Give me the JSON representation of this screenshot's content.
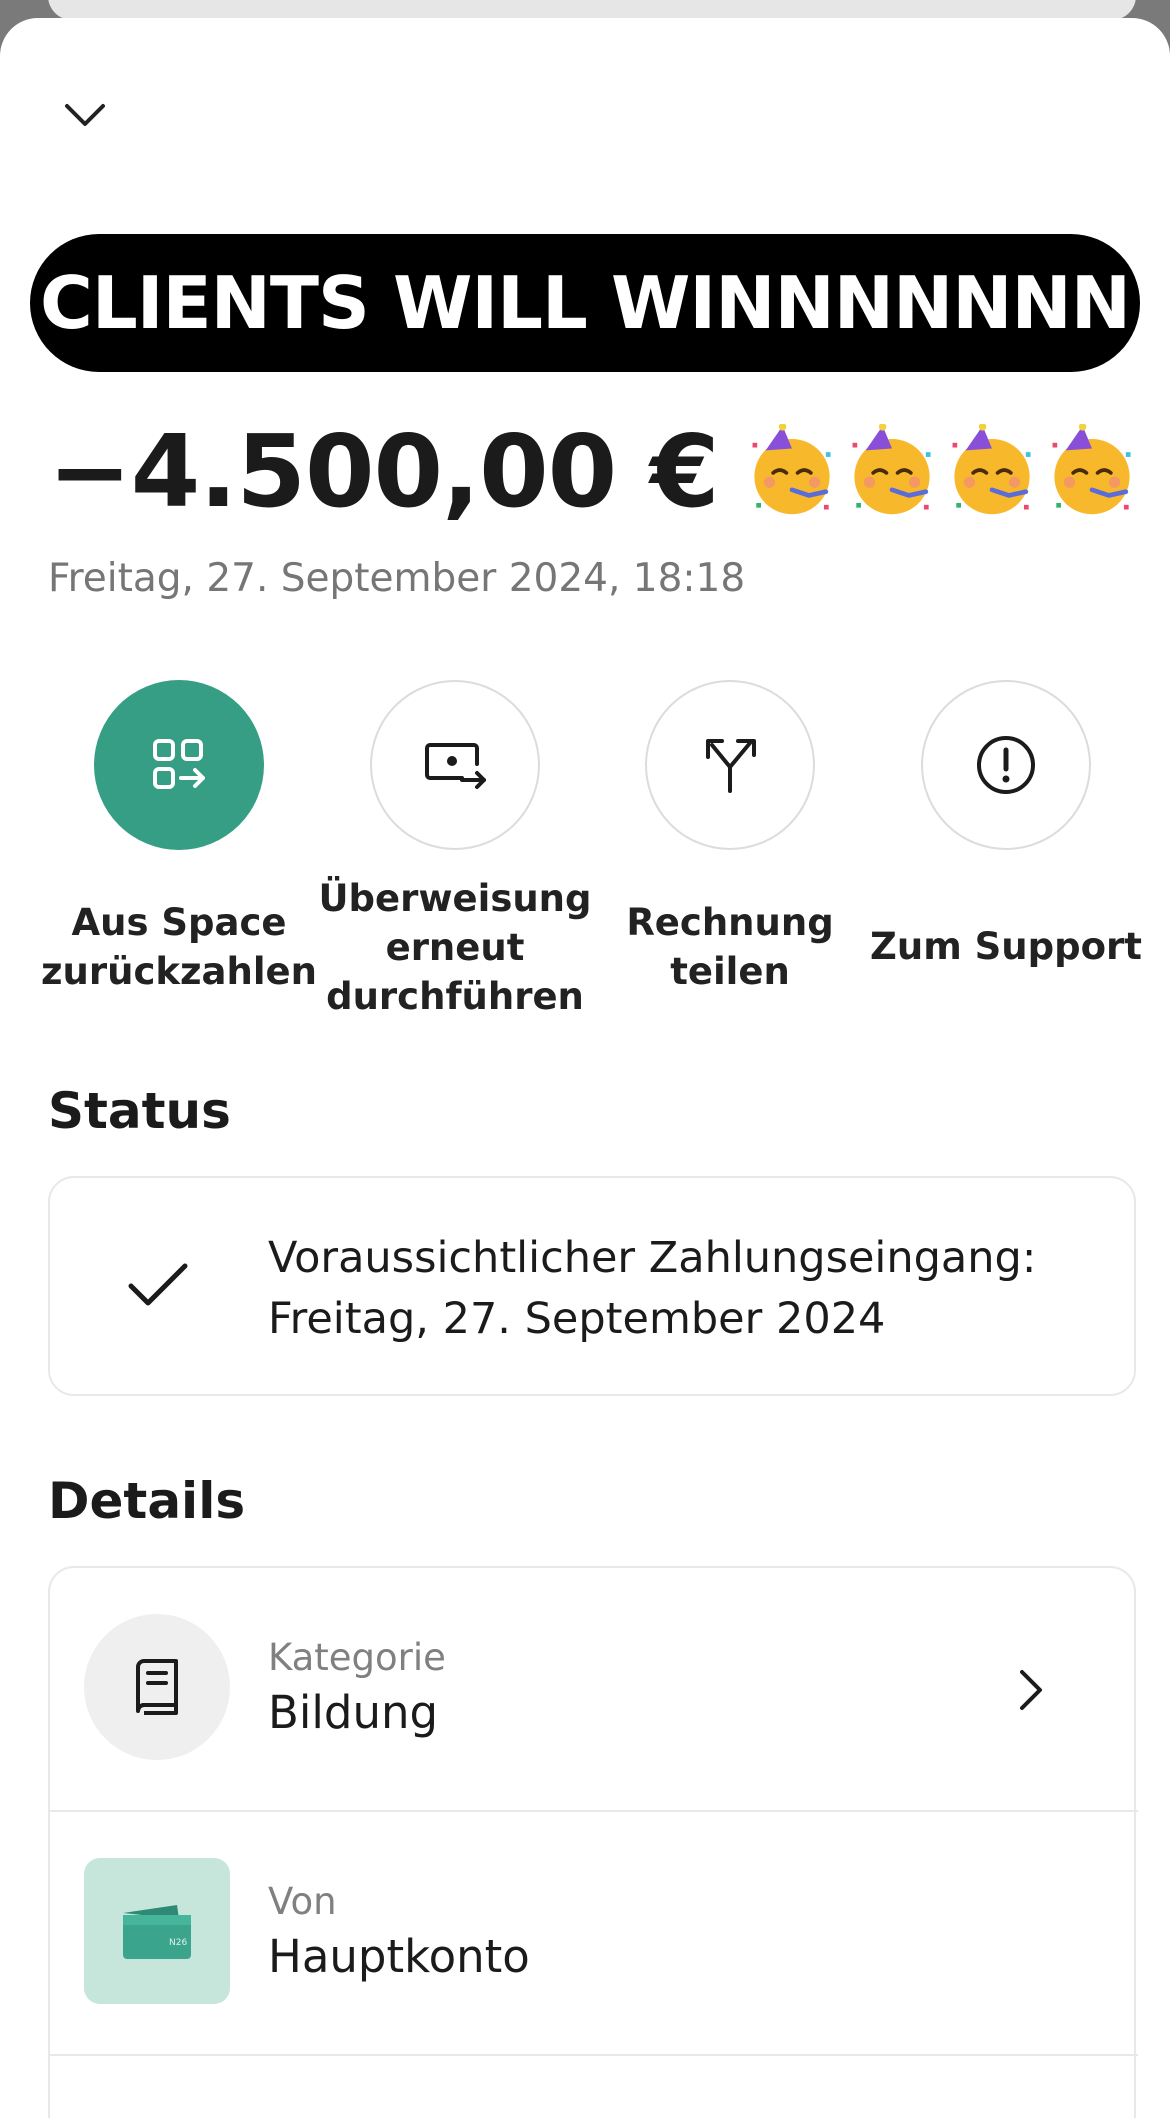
{
  "banner": {
    "text": "CLIENTS WILL WINNNNNNN"
  },
  "transaction": {
    "amount": "−4.500,00 €",
    "emoji": [
      "partying-face",
      "partying-face",
      "partying-face",
      "partying-face"
    ],
    "date": "Freitag, 27. September 2024, 18:18"
  },
  "actions": [
    {
      "lines": [
        "Aus Space",
        "zurückzahlen"
      ],
      "icon": "space-transfer-icon"
    },
    {
      "lines": [
        "Überweisung",
        "erneut",
        "durchführen"
      ],
      "icon": "repeat-transfer-icon"
    },
    {
      "lines": [
        "Rechnung",
        "teilen"
      ],
      "icon": "split-icon"
    },
    {
      "lines": [
        "Zum Support"
      ],
      "icon": "alert-circle-icon"
    }
  ],
  "status": {
    "title": "Status",
    "lines": [
      "Voraussichtlicher Zahlungseingang:",
      "Freitag, 27. September 2024"
    ]
  },
  "details": {
    "title": "Details",
    "rows": [
      {
        "label": "Kategorie",
        "value": "Bildung",
        "icon": "book-icon"
      },
      {
        "label": "Von",
        "value": "Hauptkonto",
        "icon": "wallet-icon",
        "tile_text": "N26"
      }
    ]
  },
  "colors": {
    "accent": "#369e85",
    "tile_bg": "#c6e6db",
    "banner_bg": "#000000"
  }
}
